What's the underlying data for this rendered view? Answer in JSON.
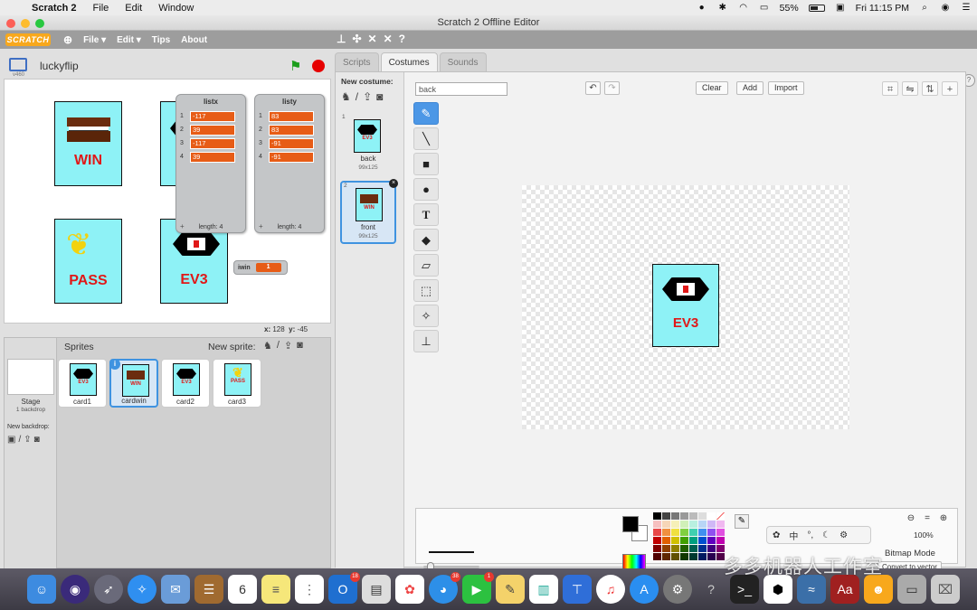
{
  "menubar": {
    "app_name": "Scratch 2",
    "items": [
      "File",
      "Edit",
      "Window"
    ],
    "battery": "55%",
    "clock": "Fri 11:15 PM"
  },
  "window": {
    "title": "Scratch 2 Offline Editor"
  },
  "scratch_menu": {
    "logo": "SCRATCH",
    "items": [
      "File ▾",
      "Edit ▾",
      "Tips",
      "About"
    ]
  },
  "stage": {
    "version": "v460",
    "project_name": "luckyflip",
    "cards": [
      {
        "label": "WIN"
      },
      {
        "label": "PASS"
      },
      {
        "label": "EV3"
      }
    ],
    "list_x": {
      "title": "listx",
      "items": [
        "-117",
        "39",
        "-117",
        "39"
      ],
      "indices": [
        "1",
        "2",
        "3",
        "4"
      ],
      "length": "length: 4"
    },
    "list_y": {
      "title": "listy",
      "items": [
        "83",
        "83",
        "-91",
        "-91"
      ],
      "indices": [
        "1",
        "2",
        "3",
        "4"
      ],
      "length": "length: 4"
    },
    "variable": {
      "name": "iwin",
      "value": "1"
    },
    "list_add": "+",
    "coord_x_label": "x:",
    "coord_x": "128",
    "coord_y_label": "y:",
    "coord_y": "-45"
  },
  "sprites_panel": {
    "title": "Sprites",
    "new_sprite": "New sprite:",
    "stage_label": "Stage",
    "stage_sub": "1 backdrop",
    "new_backdrop": "New backdrop:",
    "sprites": [
      {
        "name": "card1",
        "thumb": "EV3"
      },
      {
        "name": "cardwin",
        "thumb": "WIN"
      },
      {
        "name": "card2",
        "thumb": "EV3"
      },
      {
        "name": "card3",
        "thumb": "PASS"
      }
    ],
    "info": "i"
  },
  "tabs": [
    "Scripts",
    "Costumes",
    "Sounds"
  ],
  "costumes": {
    "new_costume": "New costume:",
    "items": [
      {
        "num": "1",
        "name": "back",
        "size": "99x125",
        "thumb": "EV3"
      },
      {
        "num": "2",
        "name": "front",
        "size": "99x125",
        "thumb": "WIN"
      }
    ],
    "current_name": "back",
    "buttons": {
      "clear": "Clear",
      "add": "Add",
      "import": "Import"
    },
    "canvas_card_label": "EV3",
    "zoom": "100%",
    "mode": "Bitmap Mode",
    "convert": "Convert to vector"
  },
  "ime": [
    "中",
    "°,",
    "☾",
    "⚙"
  ],
  "watermark": "多多机器人工作室",
  "dock_badges": {
    "outlook": "18",
    "qq": "38",
    "facetime": "1",
    "calendar_day": "6"
  }
}
